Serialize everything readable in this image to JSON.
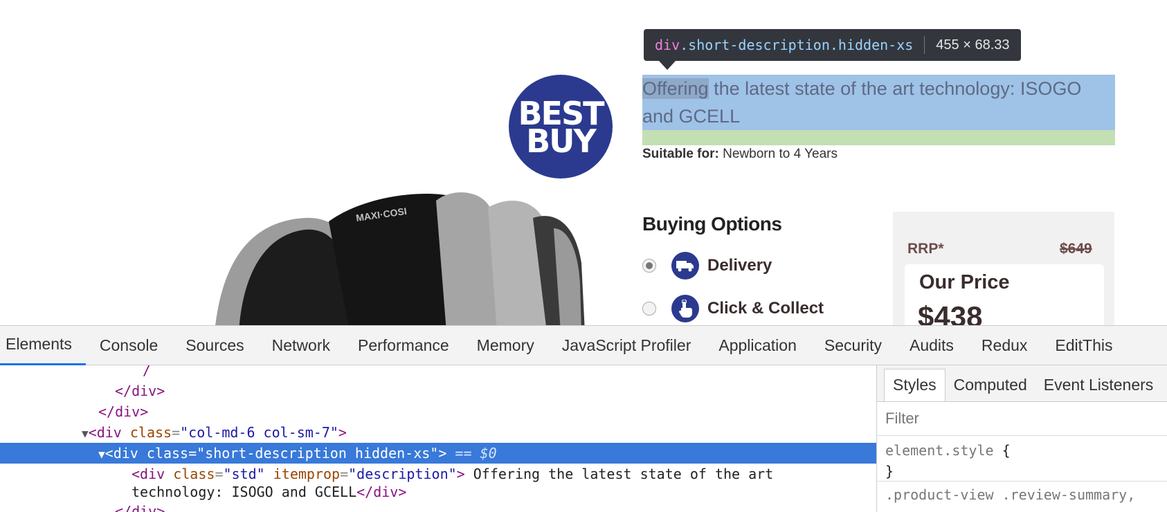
{
  "page": {
    "badge": {
      "line1": "BEST",
      "line2": "BUY"
    },
    "seat_brand": "MAXI·COSI",
    "description": {
      "selected_word": "Offering",
      "rest": " the latest state of the art technology: ISOGO and GCELL"
    },
    "suitable": {
      "label": "Suitable for:",
      "value": "Newborn to 4 Years"
    },
    "buying_options": {
      "title": "Buying Options",
      "options": [
        {
          "label": "Delivery",
          "icon": "truck-icon",
          "selected": true
        },
        {
          "label": "Click & Collect",
          "icon": "hand-pointer-icon",
          "selected": false
        }
      ]
    },
    "pricing": {
      "rrp_label": "RRP*",
      "rrp_value": "$649",
      "our_price_label": "Our Price",
      "our_price_value": "$438"
    }
  },
  "inspector_tooltip": {
    "tag": "div",
    "classes": ".short-description.hidden-xs",
    "dimensions": "455 × 68.33"
  },
  "devtools": {
    "tabs": [
      "Elements",
      "Console",
      "Sources",
      "Network",
      "Performance",
      "Memory",
      "JavaScript Profiler",
      "Application",
      "Security",
      "Audits",
      "Redux",
      "EditThis"
    ],
    "active_tab": "Elements",
    "dom_lines": {
      "l1": "</div>",
      "l2": "</div>",
      "l3_tag": "div",
      "l3_attr": "class",
      "l3_val": "\"col-md-6 col-sm-7\"",
      "l4_tag": "div",
      "l4_attr": "class",
      "l4_val": "\"short-description hidden-xs\"",
      "l4_eq": "== $0",
      "l5_tag": "div",
      "l5_attr1": "class",
      "l5_val1": "\"std\"",
      "l5_attr2": "itemprop",
      "l5_val2": "\"description\"",
      "l5_text": " Offering the latest state of the art",
      "l6_text": "technology: ISOGO and GCELL",
      "l7": "</div>"
    },
    "styles_panel": {
      "tabs": [
        "Styles",
        "Computed",
        "Event Listeners"
      ],
      "active_tab": "Styles",
      "filter_placeholder": "Filter",
      "element_style": "element.style",
      "next_rule": ".product-view .review-summary,"
    }
  }
}
